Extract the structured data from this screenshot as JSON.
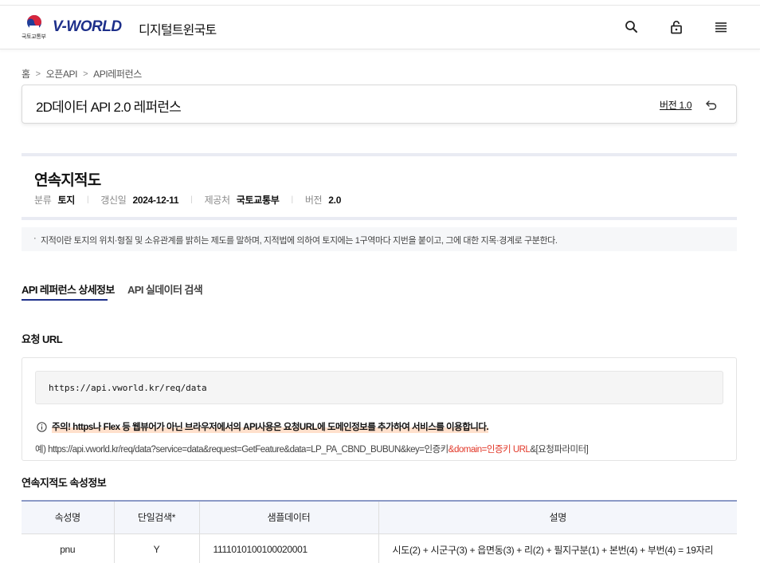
{
  "header": {
    "ministry": "국토교통부",
    "brand": "V-WORLD",
    "brand_sub": "디지털트윈국토",
    "icons": [
      "search-icon",
      "lock-icon",
      "menu-icon"
    ]
  },
  "breadcrumb": [
    "홈",
    "오픈API",
    "API레퍼런스"
  ],
  "page": {
    "title": "2D데이터 API 2.0 레퍼런스",
    "version_link": "버전 1.0"
  },
  "dataset": {
    "title": "연속지적도",
    "meta": [
      {
        "key": "분류",
        "value": "토지"
      },
      {
        "key": "갱신일",
        "value": "2024-12-11"
      },
      {
        "key": "제공처",
        "value": "국토교통부"
      },
      {
        "key": "버전",
        "value": "2.0"
      }
    ],
    "description": "지적이란 토지의 위치·형질 및 소유관계를 밝히는 제도를 말하며, 지적법에 의하여 토지에는 1구역마다 지번을 붙이고, 그에 대한 지목·경계로 구분한다."
  },
  "tabs": [
    {
      "label": "API 레퍼런스 상세정보",
      "active": true
    },
    {
      "label": "API 실데이터 검색",
      "active": false
    }
  ],
  "request": {
    "section_title": "요청 URL",
    "url": "https://api.vworld.kr/req/data",
    "notice": "주의! https나 Flex 등 웹뷰어가 아닌 브라우저에서의 API사용은 요청URL에 도메인정보를 추가하여 서비스를 이용합니다.",
    "example_prefix": "예) https://api.vworld.kr/req/data?service=data&request=GetFeature&data=LP_PA_CBND_BUBUN&key=인증키",
    "example_highlight": "&domain=인증키 URL",
    "example_suffix": "&[요청파라미터]"
  },
  "attributes": {
    "section_title": "연속지적도 속성정보",
    "columns": [
      "속성명",
      "단일검색*",
      "샘플데이터",
      "설명"
    ],
    "rows": [
      [
        "pnu",
        "Y",
        "1111010100100020001",
        "시도(2) + 시군구(3) + 읍면동(3) + 리(2) + 필지구분(1) + 본번(4) + 부번(4) = 19자리"
      ]
    ]
  },
  "colors": {
    "brand": "#1d2f8a",
    "tab_underline": "#1d2f8a",
    "highlight_red": "#e23a2b",
    "notice_highlight": "#ffe0cc"
  }
}
